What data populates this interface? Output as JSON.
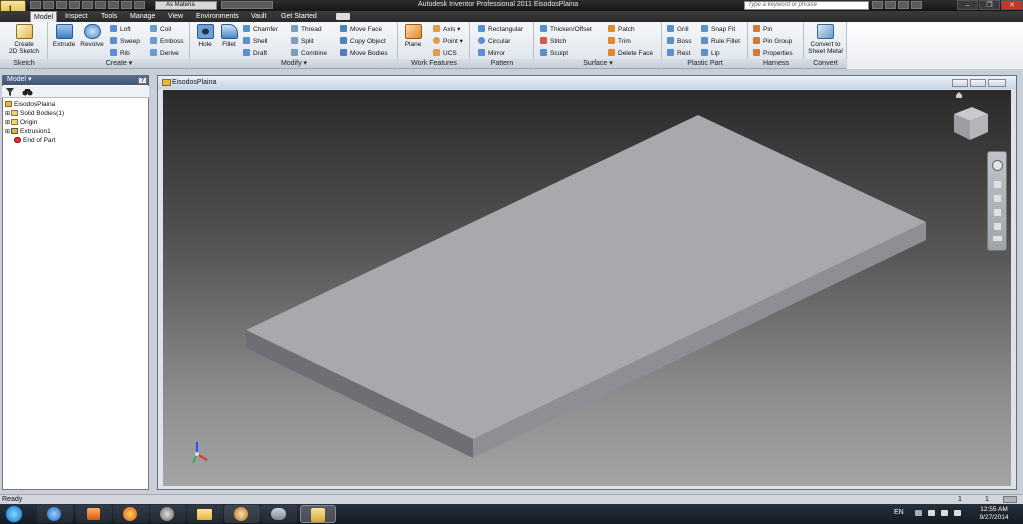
{
  "window": {
    "title": "Autodesk Inventor Professional 2011    EisodosPlaina",
    "material": "As Materia",
    "search_placeholder": "Type a keyword or phrase",
    "minimize": "–",
    "restore": "❐",
    "close": "✕",
    "app_button": "I"
  },
  "tabs": [
    "Model",
    "Inspect",
    "Tools",
    "Manage",
    "View",
    "Environments",
    "Vault",
    "Get Started"
  ],
  "ribbon": {
    "sketch": {
      "label": "Sketch",
      "create_2d_sketch": "Create\n2D Sketch"
    },
    "create": {
      "label": "Create ▾",
      "extrude": "Extrude",
      "revolve": "Revolve",
      "loft": "Loft",
      "sweep": "Sweep",
      "rib": "Rib",
      "coil": "Coil",
      "emboss": "Emboss",
      "derive": "Derive"
    },
    "modify": {
      "label": "Modify ▾",
      "hole": "Hole",
      "fillet": "Fillet",
      "chamfer": "Chamfer",
      "shell": "Shell",
      "draft": "Draft",
      "thread": "Thread",
      "split": "Split",
      "combine": "Combine",
      "move_face": "Move Face",
      "copy_object": "Copy Object",
      "move_bodies": "Move Bodies"
    },
    "work_features": {
      "label": "Work Features",
      "plane": "Plane",
      "axis": "Axis ▾",
      "point": "Point ▾",
      "ucs": "UCS"
    },
    "pattern": {
      "label": "Pattern",
      "rectangular": "Rectangular",
      "circular": "Circular",
      "mirror": "Mirror"
    },
    "surface": {
      "label": "Surface ▾",
      "thicken_offset": "Thicken/Offset",
      "stitch": "Stitch",
      "sculpt": "Sculpt",
      "patch": "Patch",
      "trim": "Trim",
      "delete_face": "Delete Face"
    },
    "plastic_part": {
      "label": "Plastic Part",
      "grill": "Grill",
      "boss": "Boss",
      "rest": "Rest",
      "snap_fit": "Snap Fit",
      "rule_fillet": "Rule Fillet",
      "lip": "Lip"
    },
    "harness": {
      "label": "Harness",
      "pin": "Pin",
      "pin_group": "Pin Group",
      "properties": "Properties"
    },
    "convert": {
      "label": "Convert",
      "convert_to_sheet_metal": "Convert to\nSheet Metal"
    }
  },
  "browser": {
    "header": "Model ▾",
    "help": "?",
    "tree": [
      {
        "label": "EisodosPlaina",
        "icon": "part-icon",
        "indent": 0
      },
      {
        "label": "Solid Bodies(1)",
        "icon": "folder-icon",
        "indent": 1
      },
      {
        "label": "Origin",
        "icon": "folder-icon",
        "indent": 1
      },
      {
        "label": "Extrusion1",
        "icon": "extrusion-icon",
        "indent": 1
      },
      {
        "label": "End of Part",
        "icon": "end-of-part-icon",
        "indent": 1
      }
    ]
  },
  "document": {
    "title": "EisodosPlaina"
  },
  "status": {
    "text": "Ready",
    "count1": "1",
    "count2": "1"
  },
  "taskbar": {
    "language": "EN",
    "time": "12:55 AM",
    "date": "9/27/2014"
  },
  "colors": {
    "accent": "#3f5675",
    "viewport_top": "#2a2a2a",
    "viewport_bottom": "#a5a5a5",
    "plate_top": "#a8a9ad"
  }
}
